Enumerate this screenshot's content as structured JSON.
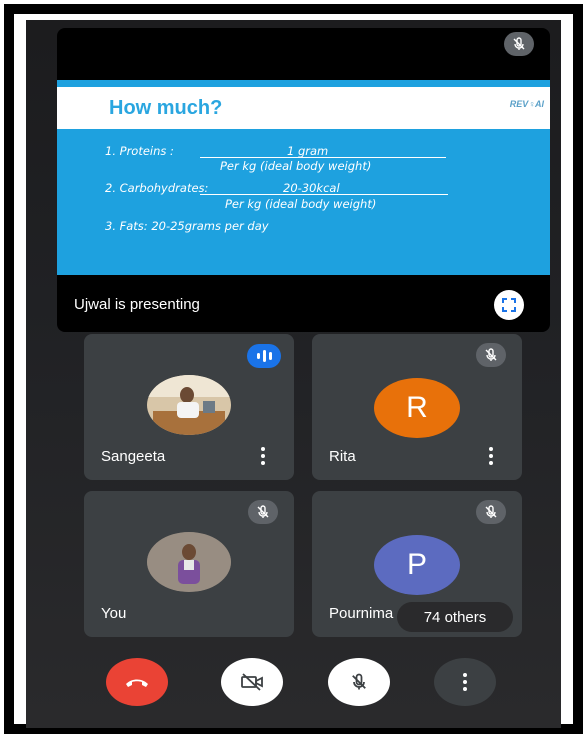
{
  "presentation": {
    "presenting_label": "Ujwal is presenting",
    "slide": {
      "title": "How much?",
      "logo_text": "REV♀Al",
      "lines": {
        "proteins_label": "1. Proteins :",
        "proteins_value": "1 gram",
        "proteins_per": "Per kg (ideal body weight)",
        "carbs_label": "2. Carbohydrates:",
        "carbs_value": "20-30kcal",
        "carbs_per": "Per kg (ideal body weight)",
        "fats": "3. Fats:  20-25grams per day"
      }
    }
  },
  "participants": [
    {
      "name": "Sangeeta",
      "avatar": "photo",
      "status": "speaking"
    },
    {
      "name": "Rita",
      "avatar_letter": "R",
      "avatar_color": "#e8710a",
      "status": "muted"
    },
    {
      "name": "You",
      "avatar": "photo",
      "status": "muted"
    },
    {
      "name": "Pournima",
      "avatar_letter": "P",
      "avatar_color": "#5c6bc0",
      "status": "muted"
    }
  ],
  "others_chip": "74 others",
  "controls": {
    "icons": [
      "end-call-icon",
      "camera-off-icon",
      "mic-off-icon",
      "more-vert-icon"
    ],
    "end_call_color": "#ea4335"
  }
}
